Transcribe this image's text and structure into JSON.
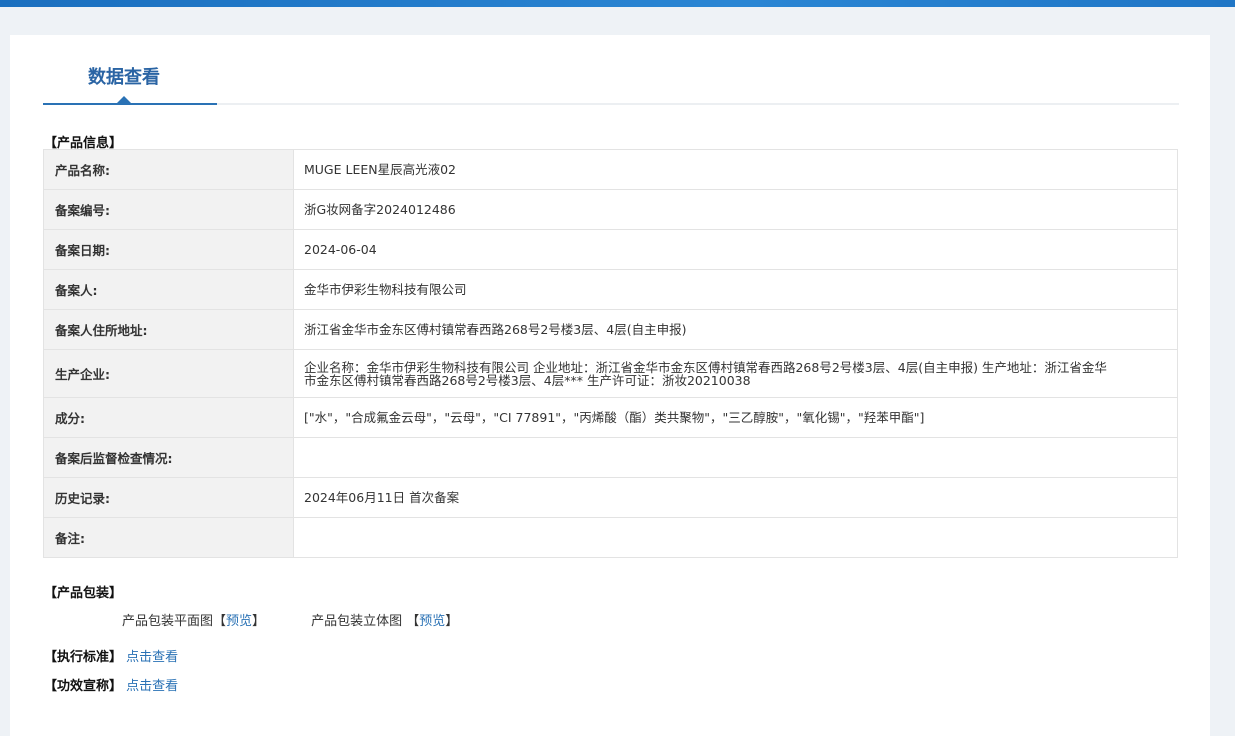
{
  "tab": {
    "title": "数据查看"
  },
  "sections": {
    "product_info": "【产品信息】",
    "packaging": "【产品包装】",
    "standard": "【执行标准】",
    "efficacy": "【功效宣称】"
  },
  "rows": [
    {
      "label": "产品名称:",
      "value": "MUGE LEEN星辰高光液02"
    },
    {
      "label": "备案编号:",
      "value": "浙G妆网备字2024012486"
    },
    {
      "label": "备案日期:",
      "value": "2024-06-04"
    },
    {
      "label": "备案人:",
      "value": "金华市伊彩生物科技有限公司"
    },
    {
      "label": "备案人住所地址:",
      "value": "浙江省金华市金东区傅村镇常春西路268号2号楼3层、4层(自主申报)"
    },
    {
      "label": "生产企业:",
      "value": "企业名称：金华市伊彩生物科技有限公司 企业地址：浙江省金华市金东区傅村镇常春西路268号2号楼3层、4层(自主申报) 生产地址：浙江省金华市金东区傅村镇常春西路268号2号楼3层、4层*** 生产许可证：浙妆20210038"
    },
    {
      "label": "成分:",
      "value": "[\"水\"，\"合成氟金云母\"，\"云母\"，\"CI 77891\"，\"丙烯酸（酯）类共聚物\"，\"三乙醇胺\"，\"氧化锡\"，\"羟苯甲酯\"]"
    },
    {
      "label": "备案后监督检查情况:",
      "value": ""
    },
    {
      "label": "历史记录:",
      "value": "2024年06月11日 首次备案"
    },
    {
      "label": "备注:",
      "value": ""
    }
  ],
  "packaging": {
    "flat_label": "产品包装平面图",
    "flat_link": "预览",
    "solid_label": "产品包装立体图",
    "solid_link": "预览",
    "open_bracket": "【",
    "close_bracket": "】"
  },
  "links": {
    "standard_link": "点击查看",
    "efficacy_link": "点击查看"
  }
}
